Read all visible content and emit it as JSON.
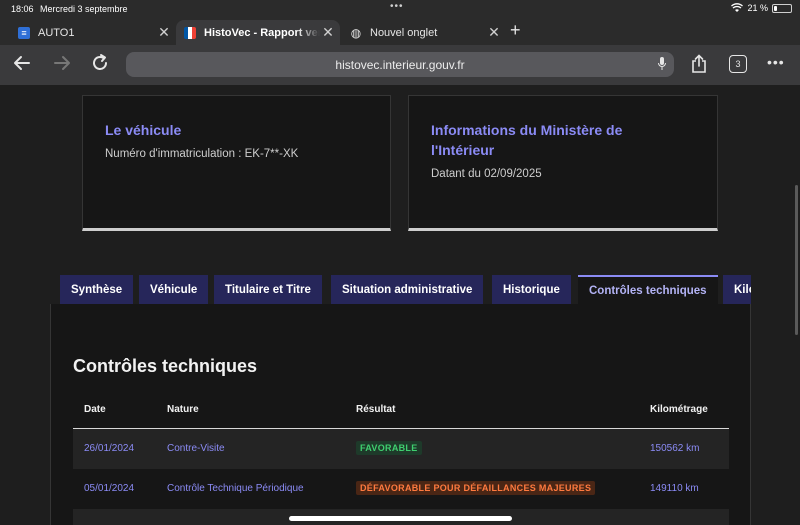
{
  "status_bar": {
    "time": "18:06",
    "date": "Mercredi 3 septembre",
    "battery": "21 %",
    "battery_level": 0.21
  },
  "tabs": [
    {
      "title": "AUTO1"
    },
    {
      "title": "HistoVec - Rapport vendeur"
    },
    {
      "title": "Nouvel onglet"
    }
  ],
  "toolbar": {
    "url": "histovec.interieur.gouv.fr",
    "tab_count": "3"
  },
  "vehicle_card": {
    "title": "Le véhicule",
    "plate": "Numéro d'immatriculation : EK-7**-XK"
  },
  "ministry_card": {
    "title": "Informations du Ministère de l'Intérieur",
    "date": "Datant du 02/09/2025"
  },
  "nav_tabs": [
    {
      "label": "Synthèse"
    },
    {
      "label": "Véhicule"
    },
    {
      "label": "Titulaire et Titre"
    },
    {
      "label": "Situation administrative"
    },
    {
      "label": "Historique"
    },
    {
      "label": "Contrôles techniques"
    },
    {
      "label": "Kilométrage"
    }
  ],
  "section": {
    "title": "Contrôles techniques",
    "headers": {
      "date": "Date",
      "nature": "Nature",
      "result": "Résultat",
      "mileage": "Kilométrage"
    },
    "rows": [
      {
        "date": "26/01/2024",
        "nature": "Contre-Visite",
        "result": "FAVORABLE",
        "mileage": "150562 km"
      },
      {
        "date": "05/01/2024",
        "nature": "Contrôle Technique Périodique",
        "result": "DÉFAVORABLE POUR DÉFAILLANCES MAJEURES",
        "mileage": "149110 km"
      }
    ]
  },
  "colors": {
    "accent": "#8b8bf5",
    "tab_bg": "#26265a",
    "favorable": "#3fcf6f",
    "defavorable": "#ff7a3f"
  }
}
